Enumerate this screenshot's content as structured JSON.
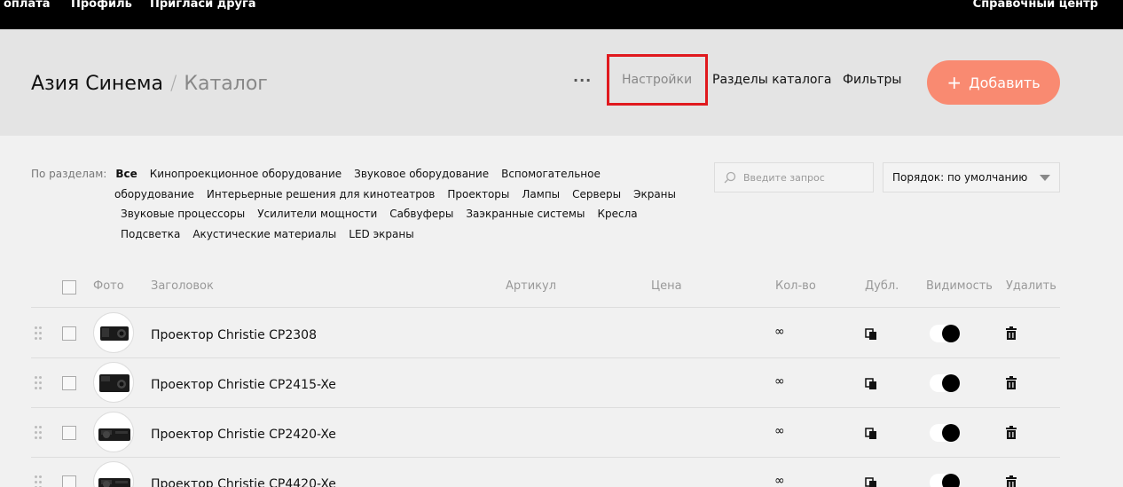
{
  "topbar": {
    "items": [
      "оплата",
      "Профиль",
      "Пригласи друга"
    ],
    "help": "Справочный центр"
  },
  "header": {
    "breadcrumb_company": "Азия Синема",
    "breadcrumb_separator": "/",
    "breadcrumb_page": "Каталог",
    "more_label": "···",
    "settings_label": "Настройки",
    "sections_label": "Разделы каталога",
    "filters_label": "Фильтры",
    "add_label": "Добавить",
    "add_plus": "+"
  },
  "filters": {
    "label": "По разделам:",
    "items": [
      "Все",
      "Кинопроекционное оборудование",
      "Звуковое оборудование",
      "Вспомогательное",
      "оборудование",
      "Интерьерные решения для кинотеатров",
      "Проекторы",
      "Лампы",
      "Серверы",
      "Экраны",
      "Звуковые процессоры",
      "Усилители мощности",
      "Сабвуферы",
      "Заэкранные системы",
      "Кресла",
      "Подсветка",
      "Акустические материалы",
      "LED экраны"
    ]
  },
  "search": {
    "placeholder": "Введите запрос"
  },
  "sort": {
    "value": "Порядок: по умолчанию"
  },
  "table": {
    "headers": {
      "photo": "Фото",
      "title": "Заголовок",
      "sku": "Артикул",
      "price": "Цена",
      "qty": "Кол-во",
      "dup": "Дубл.",
      "visibility": "Видимость",
      "delete": "Удалить"
    },
    "rows": [
      {
        "title": "Проектор Christie CP2308",
        "qty": "∞"
      },
      {
        "title": "Проектор Christie CP2415-Xe",
        "qty": "∞"
      },
      {
        "title": "Проектор Christie CP2420-Xe",
        "qty": "∞"
      },
      {
        "title": "Проектор Christie CP4420-Xe",
        "qty": "∞"
      }
    ]
  }
}
